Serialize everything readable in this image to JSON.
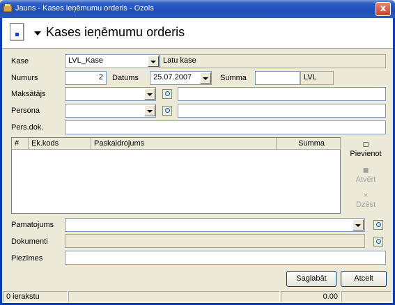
{
  "window": {
    "title": "Jauns - Kases ieņēmumu orderis - Ozols",
    "close": "x"
  },
  "header": {
    "title": "Kases ieņēmumu orderis"
  },
  "form": {
    "kase_label": "Kase",
    "kase_value": "LVL_Kase",
    "kase_name": "Latu kase",
    "numurs_label": "Numurs",
    "numurs_value": "2",
    "datums_label": "Datums",
    "datums_value": "25.07.2007",
    "summa_label": "Summa",
    "summa_value": "",
    "summa_currency": "LVL",
    "maksatajs_label": "Maksātājs",
    "persona_label": "Persona",
    "persdok_label": "Pers.dok.",
    "pamatojums_label": "Pamatojums",
    "dokumenti_label": "Dokumenti",
    "piezimes_label": "Piezīmes"
  },
  "grid": {
    "columns": [
      "#",
      "Ek.kods",
      "Paskaidrojums",
      "Summa"
    ],
    "rows": []
  },
  "side_actions": {
    "add": "Pievienot",
    "open": "Atvērt",
    "delete": "Dzēst"
  },
  "buttons": {
    "save": "Saglabāt",
    "cancel": "Atcelt"
  },
  "status": {
    "records": "0 ierakstu",
    "total": "0.00"
  }
}
